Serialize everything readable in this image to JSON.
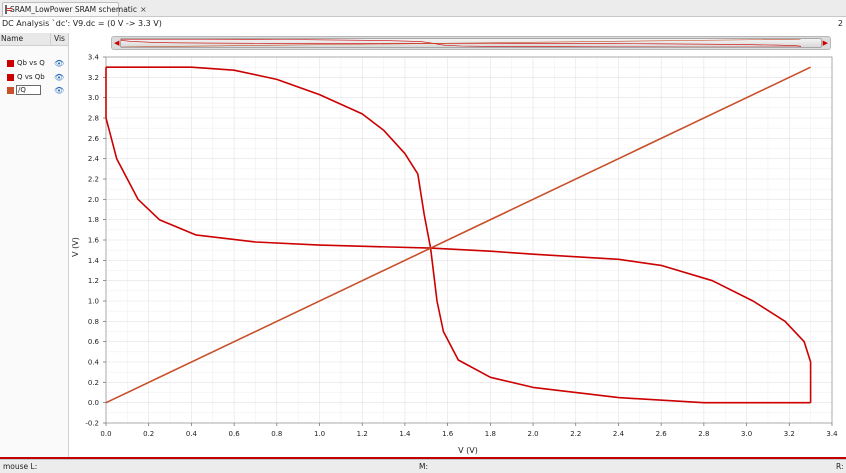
{
  "tab": {
    "label": "SRAM_LowPower SRAM schematic",
    "close": "×"
  },
  "analysis_title": "DC Analysis `dc': V9.dc = (0 V -> 3.3 V)",
  "corner_number": "2",
  "legend": {
    "header_name": "Name",
    "header_vis": "Vis",
    "items": [
      {
        "label": "Qb vs Q",
        "color": "#cc0000"
      },
      {
        "label": "Q vs Qb",
        "color": "#cc0000"
      },
      {
        "label": "/Q",
        "color": "#c8502a"
      }
    ]
  },
  "status": {
    "left": "mouse L:",
    "middle": "M:",
    "right": "R:"
  },
  "chart_data": {
    "type": "line",
    "xlabel": "V (V)",
    "ylabel": "V (V)",
    "xlim": [
      0.0,
      3.4
    ],
    "ylim": [
      -0.2,
      3.4
    ],
    "xticks": [
      "0.0",
      "0.2",
      "0.4",
      "0.6",
      "0.8",
      "1.0",
      "1.2",
      "1.4",
      "1.6",
      "1.8",
      "2.0",
      "2.2",
      "2.4",
      "2.6",
      "2.8",
      "3.0",
      "3.2",
      "3.4"
    ],
    "yticks": [
      "-0.2",
      "0.0",
      "0.2",
      "0.4",
      "0.6",
      "0.8",
      "1.0",
      "1.2",
      "1.4",
      "1.6",
      "1.8",
      "2.0",
      "2.2",
      "2.4",
      "2.6",
      "2.8",
      "3.0",
      "3.2",
      "3.4"
    ],
    "grid": true,
    "series": [
      {
        "name": "Qb vs Q",
        "color": "#cc0000",
        "points": [
          [
            0.0,
            3.3
          ],
          [
            0.2,
            3.3
          ],
          [
            0.4,
            3.3
          ],
          [
            0.6,
            3.27
          ],
          [
            0.8,
            3.18
          ],
          [
            1.0,
            3.03
          ],
          [
            1.2,
            2.84
          ],
          [
            1.3,
            2.68
          ],
          [
            1.4,
            2.45
          ],
          [
            1.46,
            2.25
          ],
          [
            1.49,
            1.85
          ],
          [
            1.52,
            1.52
          ],
          [
            1.55,
            1.0
          ],
          [
            1.58,
            0.7
          ],
          [
            1.65,
            0.42
          ],
          [
            1.8,
            0.25
          ],
          [
            2.0,
            0.15
          ],
          [
            2.4,
            0.05
          ],
          [
            2.8,
            0.0
          ],
          [
            3.3,
            0.0
          ]
        ]
      },
      {
        "name": "Q vs Qb",
        "color": "#cc0000",
        "points": [
          [
            3.3,
            0.0
          ],
          [
            3.3,
            0.2
          ],
          [
            3.3,
            0.4
          ],
          [
            3.27,
            0.6
          ],
          [
            3.18,
            0.8
          ],
          [
            3.03,
            1.0
          ],
          [
            2.84,
            1.2
          ],
          [
            2.6,
            1.35
          ],
          [
            2.4,
            1.41
          ],
          [
            2.0,
            1.46
          ],
          [
            1.8,
            1.49
          ],
          [
            1.52,
            1.52
          ],
          [
            1.0,
            1.55
          ],
          [
            0.7,
            1.58
          ],
          [
            0.42,
            1.65
          ],
          [
            0.25,
            1.8
          ],
          [
            0.15,
            2.0
          ],
          [
            0.05,
            2.4
          ],
          [
            0.0,
            2.8
          ],
          [
            0.0,
            3.3
          ]
        ]
      },
      {
        "name": "/Q",
        "color": "#c8502a",
        "points": [
          [
            0.0,
            0.0
          ],
          [
            3.3,
            3.3
          ]
        ]
      }
    ]
  }
}
